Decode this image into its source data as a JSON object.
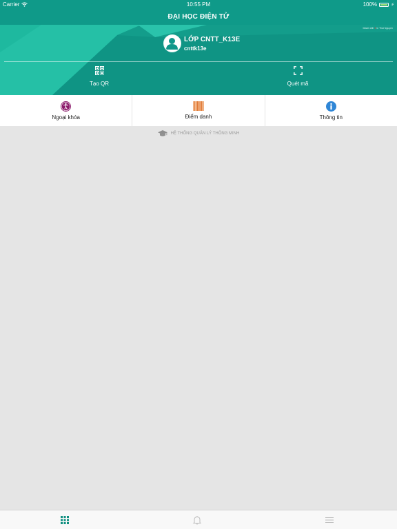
{
  "status_bar": {
    "carrier": "Carrier",
    "time": "10:55 PM",
    "battery_percent": "100%"
  },
  "nav": {
    "title": "ĐẠI HỌC ĐIỆN TỬ"
  },
  "header": {
    "made_with_text": "Made with ♥ in Thai Nguyen",
    "class_name": "LỚP CNTT_K13E",
    "username": "cnttk13e",
    "actions": [
      {
        "label": "Tạo QR",
        "icon": "qr-code-icon"
      },
      {
        "label": "Quét mã",
        "icon": "scan-frame-icon"
      }
    ]
  },
  "quick_menu": [
    {
      "label": "Ngoại khóa",
      "icon": "accessibility-icon",
      "color": "#8b1a6b"
    },
    {
      "label": "Điểm danh",
      "icon": "barcode-icon",
      "color": "#f0a060"
    },
    {
      "label": "Thông tin",
      "icon": "info-icon",
      "color": "#2f86d6"
    }
  ],
  "footer": {
    "text": "HỆ THỐNG QUẢN LÝ THÔNG MINH",
    "icon": "graduation-cap-icon"
  },
  "tab_bar": {
    "tabs": [
      {
        "icon": "grid-icon",
        "active": true
      },
      {
        "icon": "bell-icon",
        "active": false
      },
      {
        "icon": "menu-icon",
        "active": false
      }
    ]
  },
  "colors": {
    "primary": "#0f9a89",
    "header_bg": "#0f9484",
    "accent_light": "#25c0a6",
    "page_bg": "#e5e5e5",
    "tab_active": "#0f8f80"
  }
}
